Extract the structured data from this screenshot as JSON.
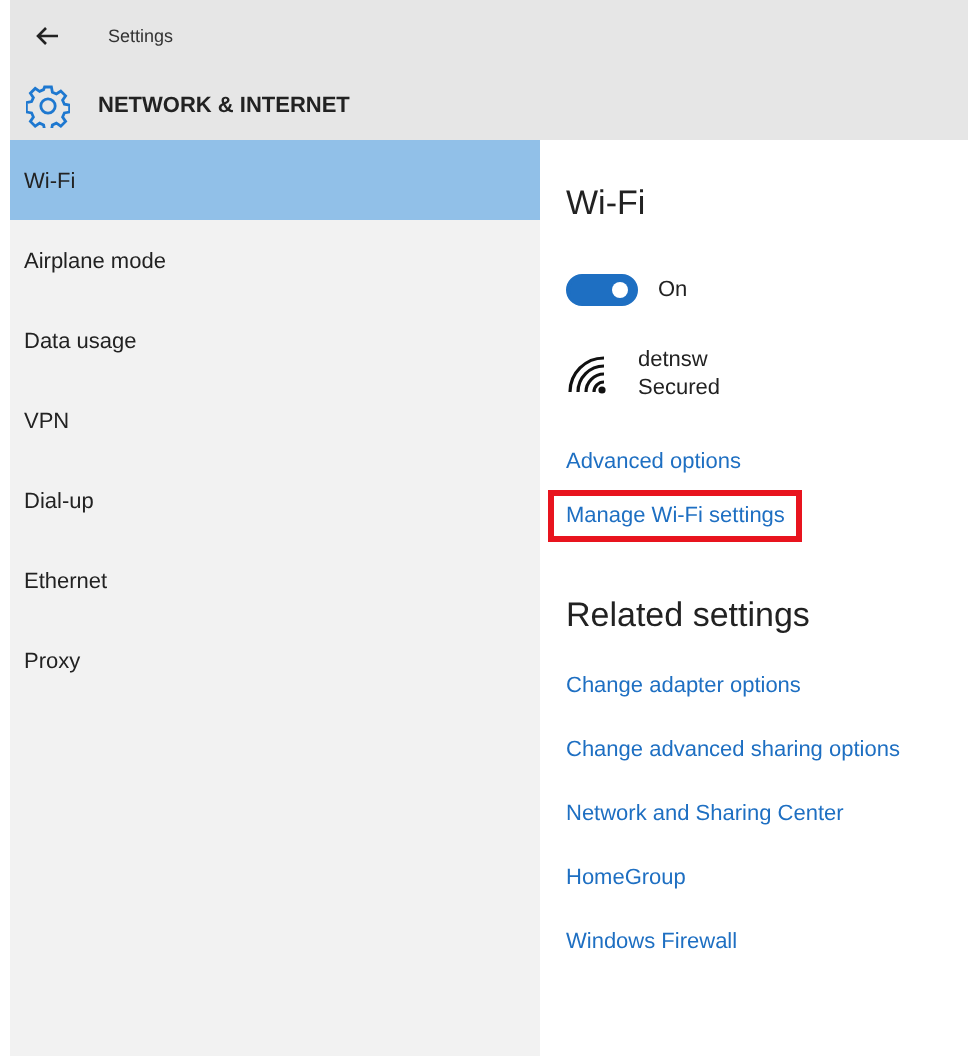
{
  "window": {
    "title": "Settings"
  },
  "header": {
    "title": "NETWORK & INTERNET"
  },
  "sidebar": {
    "items": [
      {
        "label": "Wi-Fi",
        "selected": true
      },
      {
        "label": "Airplane mode",
        "selected": false
      },
      {
        "label": "Data usage",
        "selected": false
      },
      {
        "label": "VPN",
        "selected": false
      },
      {
        "label": "Dial-up",
        "selected": false
      },
      {
        "label": "Ethernet",
        "selected": false
      },
      {
        "label": "Proxy",
        "selected": false
      }
    ]
  },
  "wifi": {
    "heading": "Wi-Fi",
    "toggle": {
      "on": true,
      "label": "On"
    },
    "network": {
      "name": "detnsw",
      "status": "Secured"
    },
    "links": [
      {
        "label": "Advanced options",
        "highlighted": false
      },
      {
        "label": "Manage Wi-Fi settings",
        "highlighted": true
      }
    ]
  },
  "related": {
    "heading": "Related settings",
    "links": [
      {
        "label": "Change adapter options"
      },
      {
        "label": "Change advanced sharing options"
      },
      {
        "label": "Network and Sharing Center"
      },
      {
        "label": "HomeGroup"
      },
      {
        "label": "Windows Firewall"
      }
    ]
  }
}
